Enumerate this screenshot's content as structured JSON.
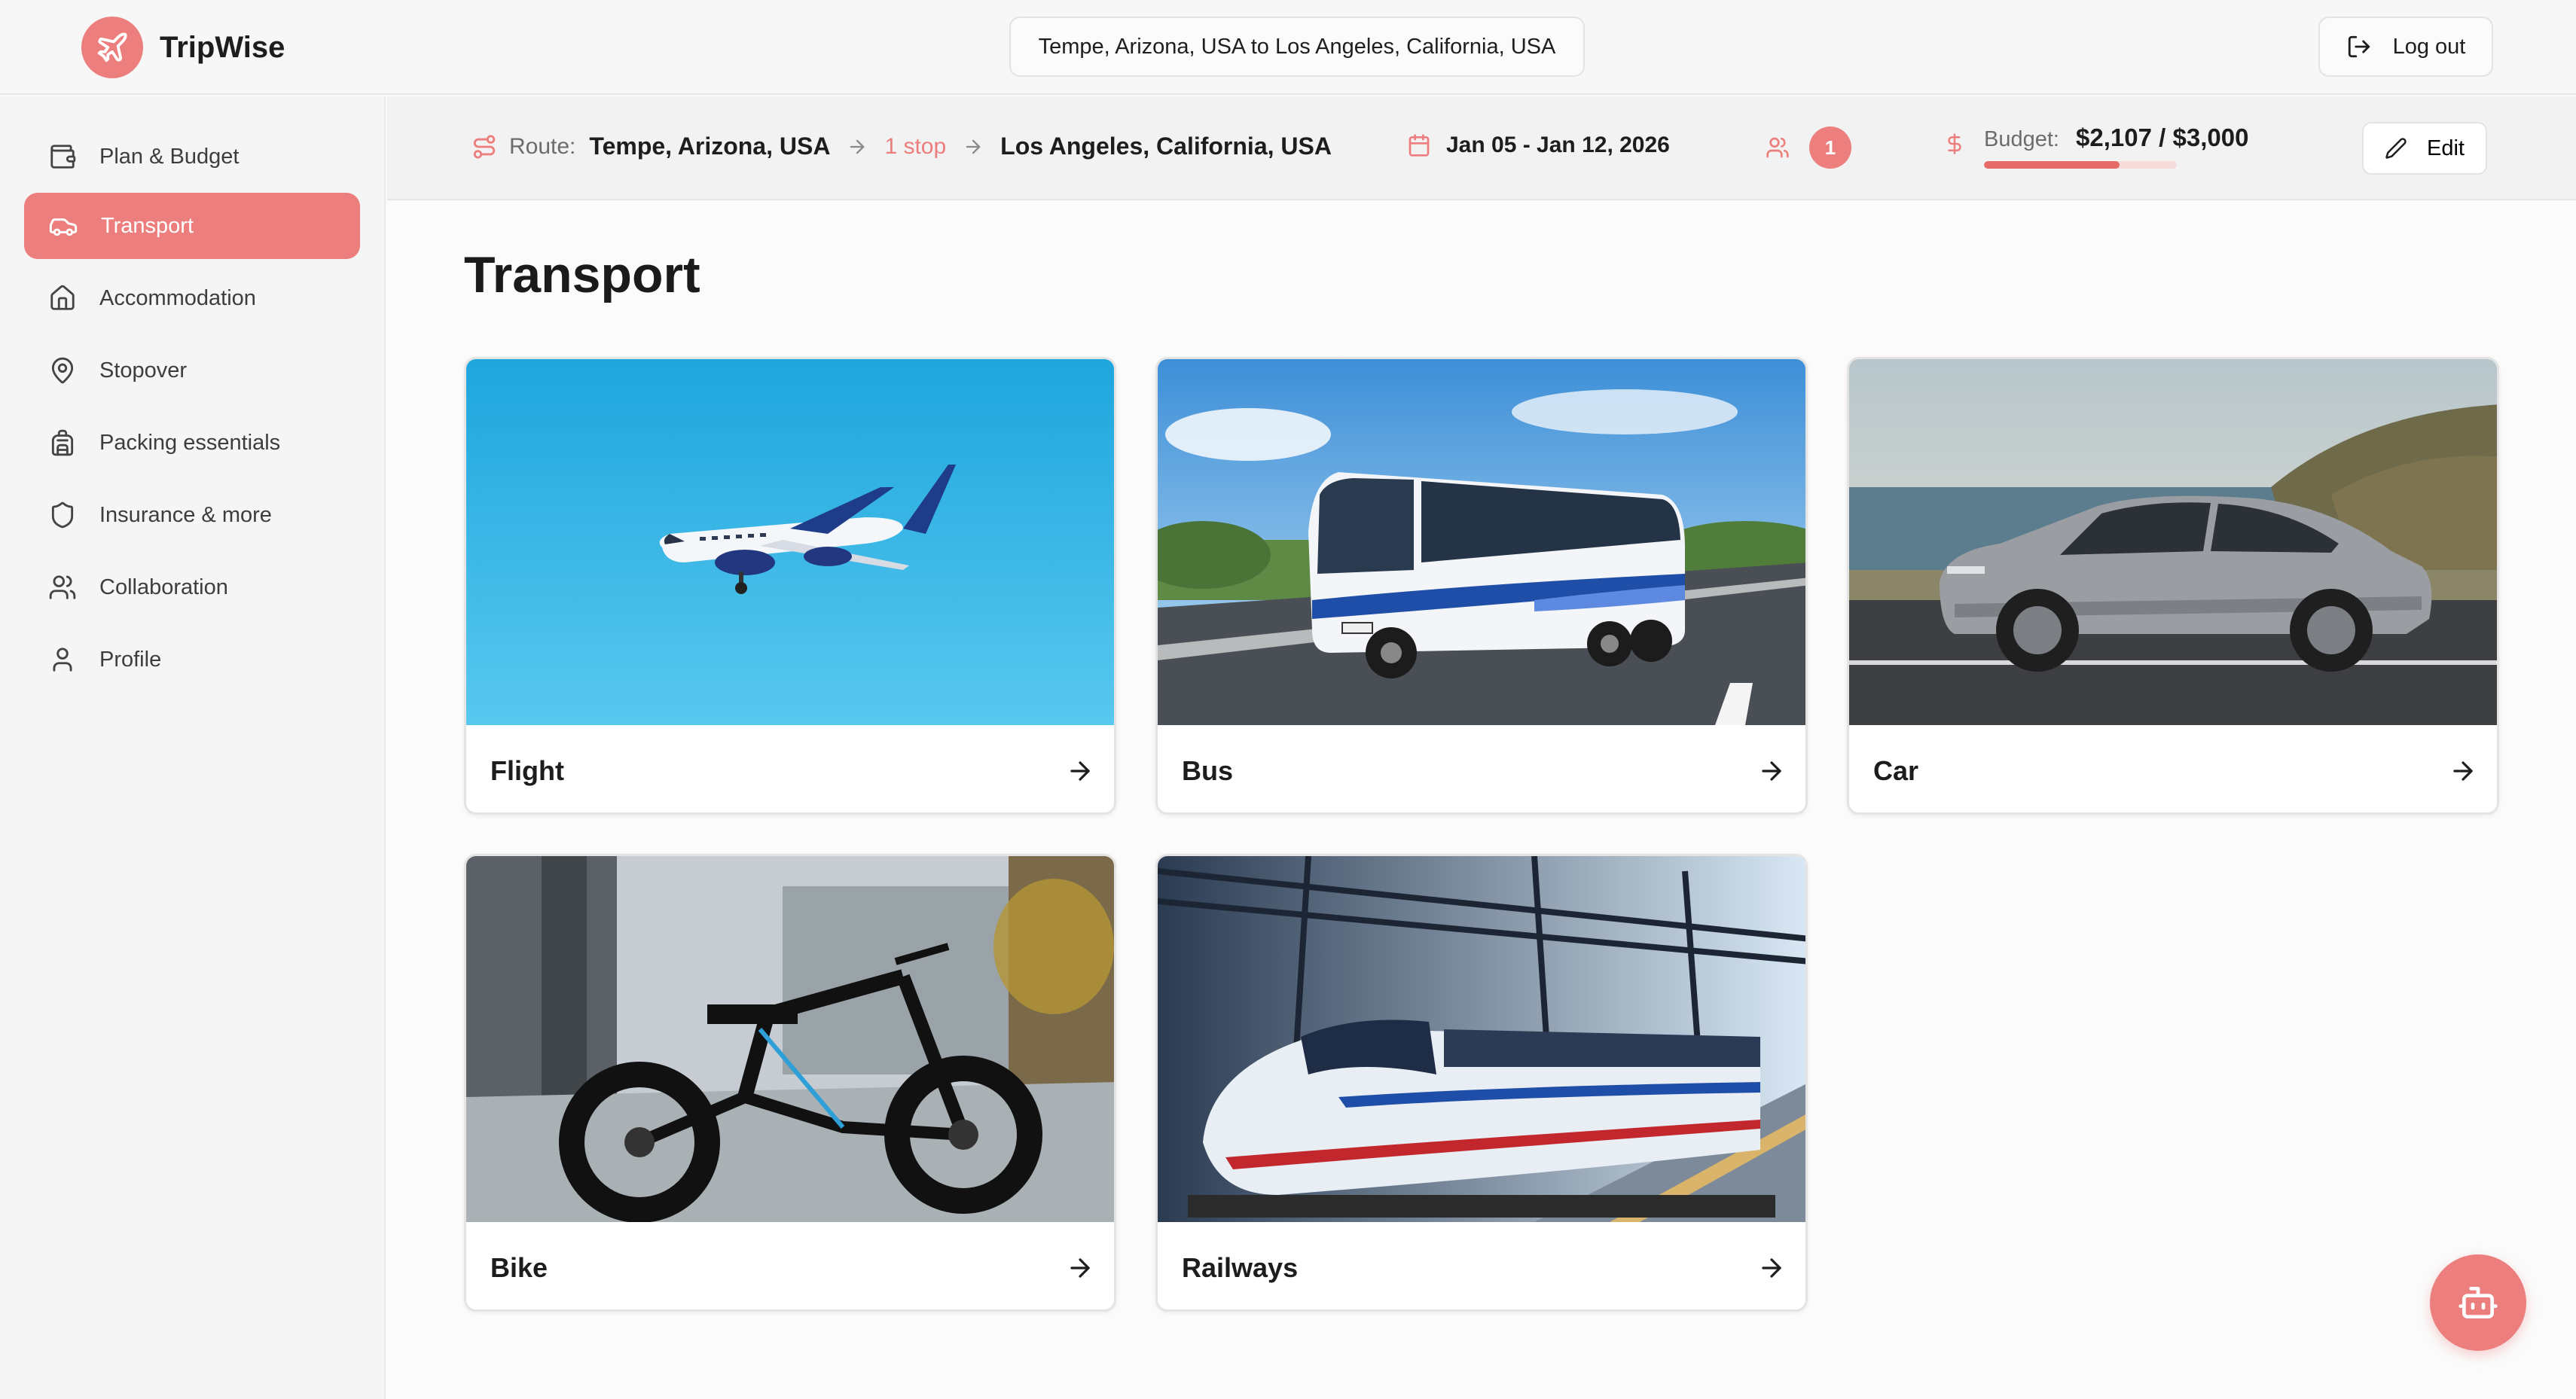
{
  "app": {
    "name": "TripWise"
  },
  "header": {
    "route_summary": "Tempe, Arizona, USA to Los Angeles, California, USA",
    "logout_label": "Log out"
  },
  "sidebar": {
    "items": [
      {
        "label": "Plan & Budget",
        "icon": "wallet-icon"
      },
      {
        "label": "Transport",
        "icon": "car-icon",
        "active": true
      },
      {
        "label": "Accommodation",
        "icon": "home-icon"
      },
      {
        "label": "Stopover",
        "icon": "map-pin-icon"
      },
      {
        "label": "Packing essentials",
        "icon": "luggage-icon"
      },
      {
        "label": "Insurance & more",
        "icon": "shield-icon"
      },
      {
        "label": "Collaboration",
        "icon": "users-icon"
      },
      {
        "label": "Profile",
        "icon": "user-icon"
      }
    ]
  },
  "trip": {
    "route_label": "Route:",
    "origin": "Tempe, Arizona, USA",
    "stops": "1 stop",
    "destination": "Los Angeles, California, USA",
    "dates": "Jan 05 - Jan 12, 2026",
    "travelers": "1",
    "budget_label": "Budget:",
    "budget_amount": "$2,107 / $3,000",
    "budget_fraction": 0.7023,
    "edit_label": "Edit"
  },
  "main": {
    "title": "Transport",
    "cards": [
      {
        "label": "Flight"
      },
      {
        "label": "Bus"
      },
      {
        "label": "Car"
      },
      {
        "label": "Bike"
      },
      {
        "label": "Railways"
      }
    ]
  },
  "colors": {
    "accent": "#ec7f7d",
    "accent_dark": "#e56b68",
    "budget_track": "#f7dcdc"
  }
}
